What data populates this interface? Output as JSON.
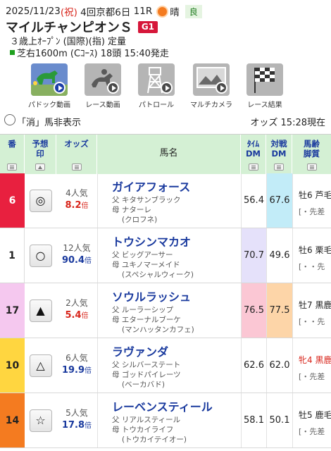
{
  "race": {
    "date": "2025/11/23",
    "holiday": "(祝)",
    "meeting": "4回京都6日",
    "race_no": "11R",
    "weather": "晴",
    "track_condition": "良",
    "name": "マイルチャンピオンＳ",
    "grade": "G1",
    "conditions": "３歳上ｵｰﾌﾟﾝ (国際)(指) 定量",
    "course_info": "芝右1600m (Cｺｰｽ) 18頭 15:40発走"
  },
  "colors": {
    "frame1": "#ffffff",
    "frame3": "#e8203f",
    "frame5": "#f5e2f5",
    "frame6": "#ffd640",
    "frame7": "#f47b20",
    "header_green": "#d4f0d4",
    "dm_purple": "#e5e1fa",
    "dm_cyan": "#c2ecf8",
    "dm_pink": "#fbc7d4",
    "dm_orange": "#fdd5a8",
    "link_blue": "#1a3a9e",
    "odds_red": "#d8261c"
  },
  "videos": [
    {
      "label": "パドック動画",
      "icon": "paddock-horse-icon"
    },
    {
      "label": "レース動画",
      "icon": "race-jockey-icon"
    },
    {
      "label": "パトロール",
      "icon": "patrol-tower-icon"
    },
    {
      "label": "マルチカメラ",
      "icon": "multi-camera-icon"
    },
    {
      "label": "レース結果",
      "icon": "checkered-flag-icon"
    }
  ],
  "filter": {
    "label": "「消」馬非表示",
    "odds_time": "オッズ 15:28現在"
  },
  "columns": {
    "num": "番",
    "mark": "予想 印",
    "odds": "オッズ",
    "name": "馬名",
    "time_dm": "ﾀｲﾑ DM",
    "battle_dm": "対戦 DM",
    "age": "馬齢 脚質"
  },
  "horses": [
    {
      "num": "6",
      "mark": "◎",
      "popularity": "4人気",
      "odds": "8.2",
      "odds_unit": "倍",
      "name": "ガイアフォース",
      "sire": "父 キタサンブラック",
      "dam": "母 ナターレ",
      "damsire": "(クロフネ)",
      "time_dm": "56.4",
      "battle_dm": "67.6",
      "age": "牡6 芦毛",
      "style": "[・先差"
    },
    {
      "num": "1",
      "mark": "○",
      "popularity": "12人気",
      "odds": "90.4",
      "odds_unit": "倍",
      "name": "トウシンマカオ",
      "sire": "父 ビッグアーサー",
      "dam": "母 ユキノマーメイド",
      "damsire": "(スペシャルウィーク)",
      "time_dm": "70.7",
      "battle_dm": "49.6",
      "age": "牡6 栗毛",
      "style": "[・・先"
    },
    {
      "num": "17",
      "mark": "▲",
      "popularity": "2人気",
      "odds": "5.4",
      "odds_unit": "倍",
      "name": "ソウルラッシュ",
      "sire": "父 ルーラーシップ",
      "dam": "母 エターナルブーケ",
      "damsire": "(マンハッタンカフェ)",
      "time_dm": "76.5",
      "battle_dm": "77.5",
      "age": "牡7 黒鹿",
      "style": "[・・先"
    },
    {
      "num": "10",
      "mark": "△",
      "popularity": "6人気",
      "odds": "19.9",
      "odds_unit": "倍",
      "name": "ラヴァンダ",
      "sire": "父 シルバーステート",
      "dam": "母 ゴッドパイレーツ",
      "damsire": "(ベーカバド)",
      "time_dm": "62.6",
      "battle_dm": "62.0",
      "age": "牝4 黒鹿",
      "style": "[・先差"
    },
    {
      "num": "14",
      "mark": "☆",
      "popularity": "5人気",
      "odds": "17.8",
      "odds_unit": "倍",
      "name": "レーベンスティール",
      "sire": "父 リアルスティール",
      "dam": "母 トウカイライフ",
      "damsire": "(トウカイテイオー)",
      "time_dm": "58.1",
      "battle_dm": "50.1",
      "age": "牡5 鹿毛",
      "style": "[・先差"
    }
  ]
}
